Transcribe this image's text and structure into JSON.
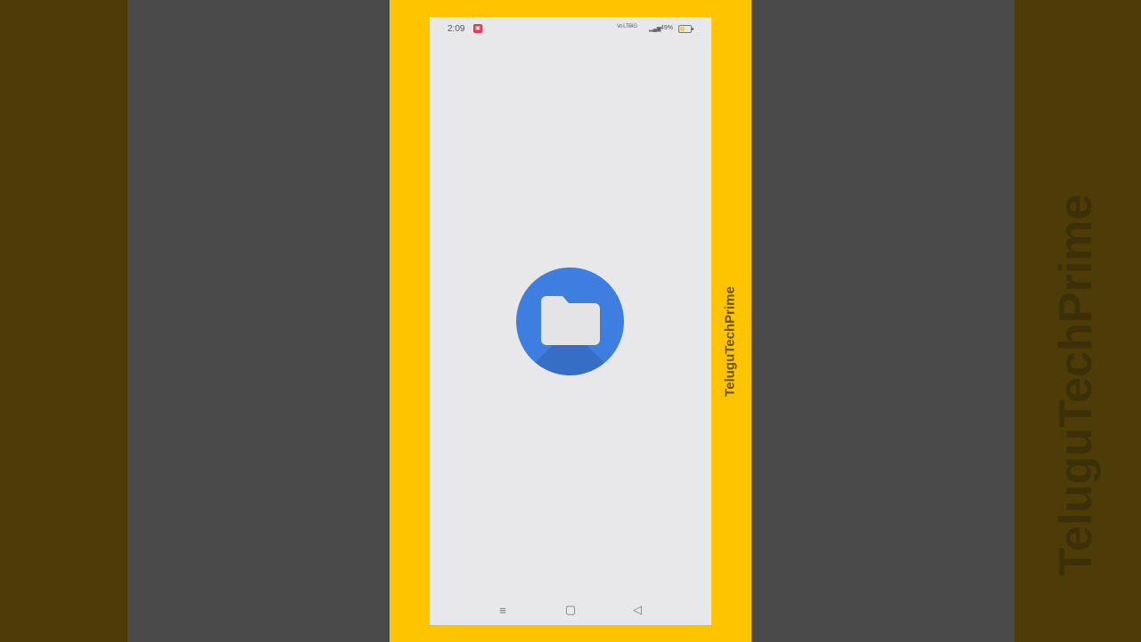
{
  "status_bar": {
    "time": "2:09",
    "notification_badge": "▣",
    "signal1": "Vo LTE",
    "signal2": "4G",
    "signal_bars": "▂▄▆",
    "battery_percent": "49%",
    "battery_level": 0.49,
    "battery_color": "#f2d24b"
  },
  "app": {
    "icon": "folder-icon",
    "icon_color": "#3d7ee0"
  },
  "nav_bar": {
    "menu_icon": "≡",
    "home_icon": "▢",
    "back_icon": "◁"
  },
  "watermark": {
    "text": "TeluguTechPrime"
  }
}
